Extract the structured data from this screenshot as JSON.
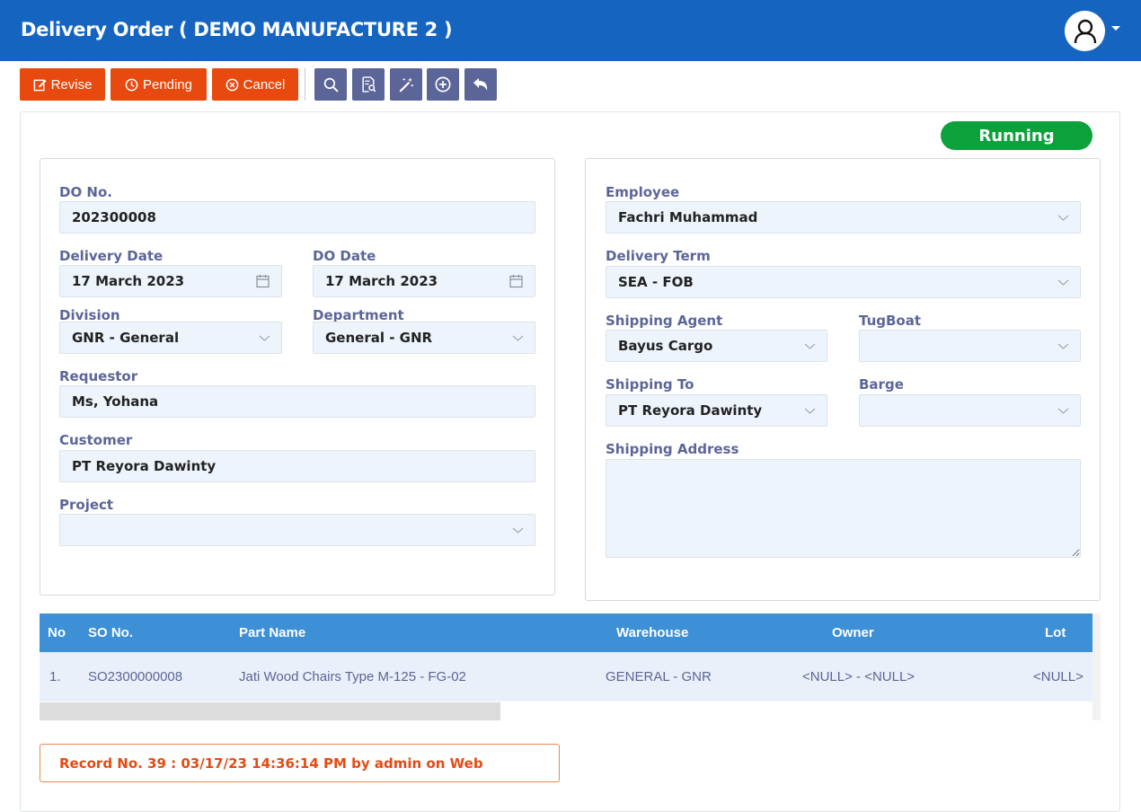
{
  "header": {
    "title": "Delivery Order ( DEMO MANUFACTURE 2 )",
    "user_icon": "user-icon"
  },
  "toolbar": {
    "revise_label": "Revise",
    "pending_label": "Pending",
    "cancel_label": "Cancel",
    "icon_buttons": [
      "search-icon",
      "document-search-icon",
      "magic-wand-icon",
      "add-circle-icon",
      "undo-icon"
    ]
  },
  "status_badge": "Running",
  "left_panel": {
    "do_no_label": "DO No.",
    "do_no_value": "202300008",
    "delivery_date_label": "Delivery Date",
    "delivery_date_value": "17 March 2023",
    "do_date_label": "DO Date",
    "do_date_value": "17 March 2023",
    "division_label": "Division",
    "division_value": "GNR - General",
    "department_label": "Department",
    "department_value": "General - GNR",
    "requestor_label": "Requestor",
    "requestor_value": "Ms, Yohana",
    "customer_label": "Customer",
    "customer_value": "PT Reyora Dawinty",
    "project_label": "Project",
    "project_value": ""
  },
  "right_panel": {
    "employee_label": "Employee",
    "employee_value": "Fachri Muhammad",
    "delivery_term_label": "Delivery Term",
    "delivery_term_value": "SEA - FOB",
    "shipping_agent_label": "Shipping Agent",
    "shipping_agent_value": "Bayus Cargo",
    "tugboat_label": "TugBoat",
    "tugboat_value": "",
    "shipping_to_label": "Shipping To",
    "shipping_to_value": "PT Reyora Dawinty",
    "barge_label": "Barge",
    "barge_value": "",
    "shipping_address_label": "Shipping Address",
    "shipping_address_value": ""
  },
  "grid": {
    "columns": [
      "No",
      "SO No.",
      "Part Name",
      "Warehouse",
      "Owner",
      "Lot"
    ],
    "rows": [
      {
        "no": "1.",
        "so_no": "SO2300000008",
        "part_name": "Jati Wood Chairs Type M-125 - FG-02",
        "warehouse": "GENERAL - GNR",
        "owner": "<NULL> - <NULL>",
        "lot": "<NULL>"
      }
    ]
  },
  "record_info": "Record No. 39 : 03/17/23 14:36:14 PM by admin on Web",
  "colors": {
    "header": "#1565c0",
    "action_red": "#e8490f",
    "icon_button": "#5c6598",
    "running_green": "#0ca13a",
    "grid_header": "#3d8fd6"
  }
}
